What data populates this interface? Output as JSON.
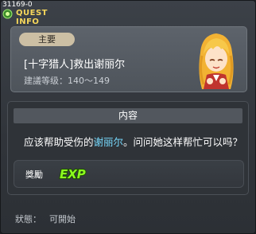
{
  "window": {
    "quest_id": "31169-0",
    "title": "QUEST INFO"
  },
  "quest": {
    "badge": "主要",
    "name": "[十字猎人]救出谢丽尔",
    "level": "建議等级：140～149"
  },
  "content": {
    "header": "内容",
    "desc_before": "应该帮助受伤的",
    "desc_highlight": "谢丽尔",
    "desc_after": "。问问她这样帮忙可以吗？"
  },
  "reward": {
    "label": "獎勵",
    "exp_text": "EXP",
    "exp_icon": "exp-icon"
  },
  "status": {
    "label": "狀態：",
    "value": "可開始"
  },
  "colors": {
    "title": "#f6d75b",
    "highlight": "#78dbff",
    "exp_green": "#8cff1e"
  },
  "icons": {
    "title": "quest-info-icon",
    "npc": "npc-portrait"
  }
}
